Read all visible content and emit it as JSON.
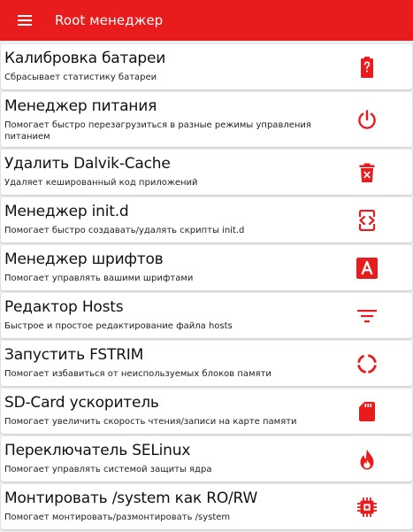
{
  "app": {
    "title": "Root менеджер",
    "accent_color": "#e81c1c",
    "menu_icon": "menu-icon"
  },
  "items": [
    {
      "title": "Калибровка батареи",
      "subtitle": "Сбрасывает статистику батареи",
      "icon": "battery-alert-icon"
    },
    {
      "title": "Менеджер питания",
      "subtitle": "Помогает быстро перезагрузиться в разные режимы управления питанием",
      "icon": "power-icon"
    },
    {
      "title": "Удалить Dalvik-Cache",
      "subtitle": "Удаляет кешированный код приложений",
      "icon": "delete-forever-icon"
    },
    {
      "title": "Менеджер init.d",
      "subtitle": "Помогает быстро создавать/удалять скрипты init.d",
      "icon": "code-icon"
    },
    {
      "title": "Менеджер шрифтов",
      "subtitle": "Помогает управлять вашими шрифтами",
      "icon": "font-icon"
    },
    {
      "title": "Редактор Hosts",
      "subtitle": "Быстрое и простое редактирование файла hosts",
      "icon": "filter-list-icon"
    },
    {
      "title": "Запустить FSTRIM",
      "subtitle": "Помогает избавиться от неиспользуемых блоков памяти",
      "icon": "refresh-ring-icon"
    },
    {
      "title": "SD-Card ускоритель",
      "subtitle": "Помогает увеличить скорость чтения/записи на карте памяти",
      "icon": "sd-card-icon"
    },
    {
      "title": "Переключатель SELinux",
      "subtitle": "Помогает управлять системой защиты ядра",
      "icon": "flame-icon"
    },
    {
      "title": "Монтировать /system как RO/RW",
      "subtitle": "Помогает монтировать/размонтировать /system",
      "icon": "chip-icon"
    }
  ]
}
